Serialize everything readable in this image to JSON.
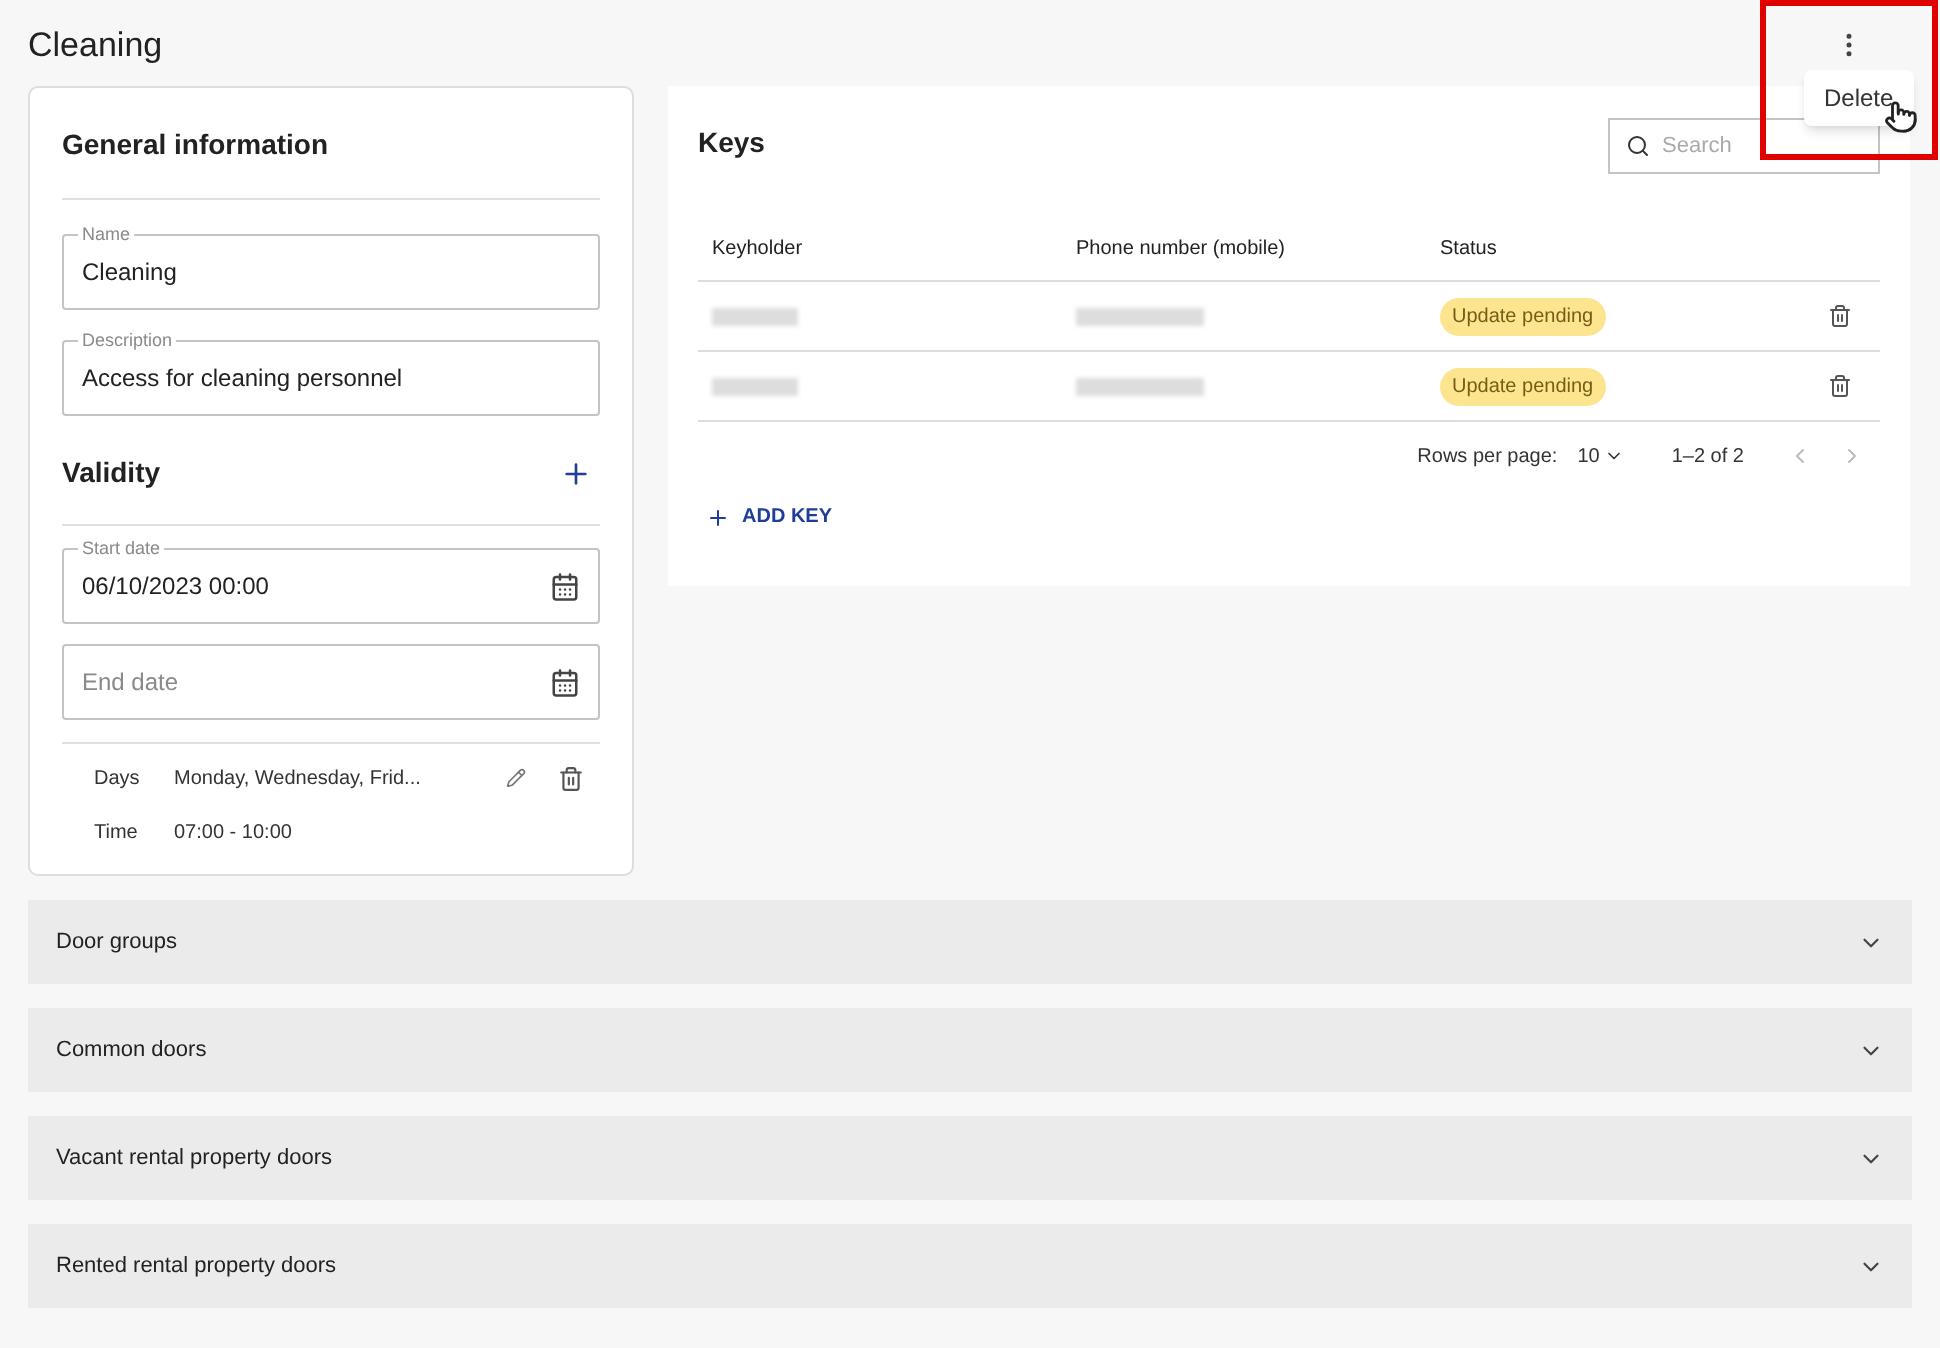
{
  "page": {
    "title": "Cleaning",
    "menu": {
      "open": true,
      "items": [
        "Delete"
      ]
    }
  },
  "general": {
    "title": "General information",
    "fields": [
      {
        "label": "Name",
        "value": "Cleaning"
      },
      {
        "label": "Description",
        "value": "Access for cleaning personnel"
      }
    ]
  },
  "validity": {
    "title": "Validity",
    "start": {
      "label": "Start date",
      "value": "06/10/2023 00:00"
    },
    "end": {
      "placeholder": "End date"
    },
    "schedule": [
      {
        "label": "Days",
        "value": "Monday, Wednesday, Frid..."
      },
      {
        "label": "Time",
        "value": "07:00 - 10:00"
      }
    ]
  },
  "keys": {
    "title": "Keys",
    "search": {
      "placeholder": "Search"
    },
    "columns": [
      "Keyholder",
      "Phone number (mobile)",
      "Status"
    ],
    "rows": [
      {
        "status": "Update pending"
      },
      {
        "status": "Update pending"
      }
    ],
    "pagination": {
      "rows_label": "Rows per page:",
      "rows_value": "10",
      "range": "1–2 of 2",
      "nav": [
        {
          "kind": "prev",
          "disabled": true
        },
        {
          "kind": "next",
          "disabled": true
        }
      ]
    },
    "add_button": "ADD KEY"
  },
  "sections": [
    {
      "title": "Door groups",
      "expanded": false
    },
    {
      "title": "Common doors",
      "expanded": false
    },
    {
      "title": "Vacant rental property doors",
      "expanded": false
    },
    {
      "title": "Rented rental property doors",
      "expanded": false
    }
  ]
}
